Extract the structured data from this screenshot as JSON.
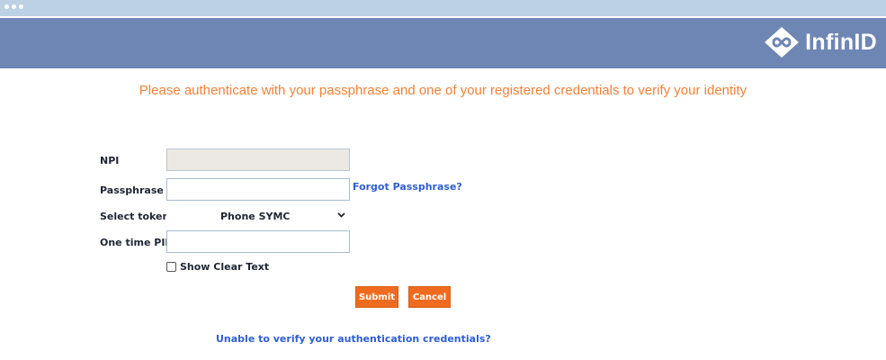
{
  "app": {
    "logo_text": "InfinID"
  },
  "form": {
    "headline": "Please authenticate with your passphrase and one of your registered credentials to verify your identity",
    "npi_label": "NPI",
    "npi_value": "",
    "passphrase_label": "Passphrase",
    "passphrase_value": "",
    "forgot_link": "Forgot Passphrase?",
    "token_label": "Select token",
    "token_selected": "Phone  SYMC",
    "pin_label": "One time PIN",
    "pin_value": "",
    "show_clear_text": "Show Clear Text",
    "submit_label": "Submit",
    "cancel_label": "Cancel",
    "unable_link": "Unable to verify your authentication credentials?"
  },
  "colors": {
    "header_bg": "#6e86b3",
    "headline": "#f0823a",
    "button_bg": "#ef6b20",
    "link": "#2f5ed1"
  }
}
